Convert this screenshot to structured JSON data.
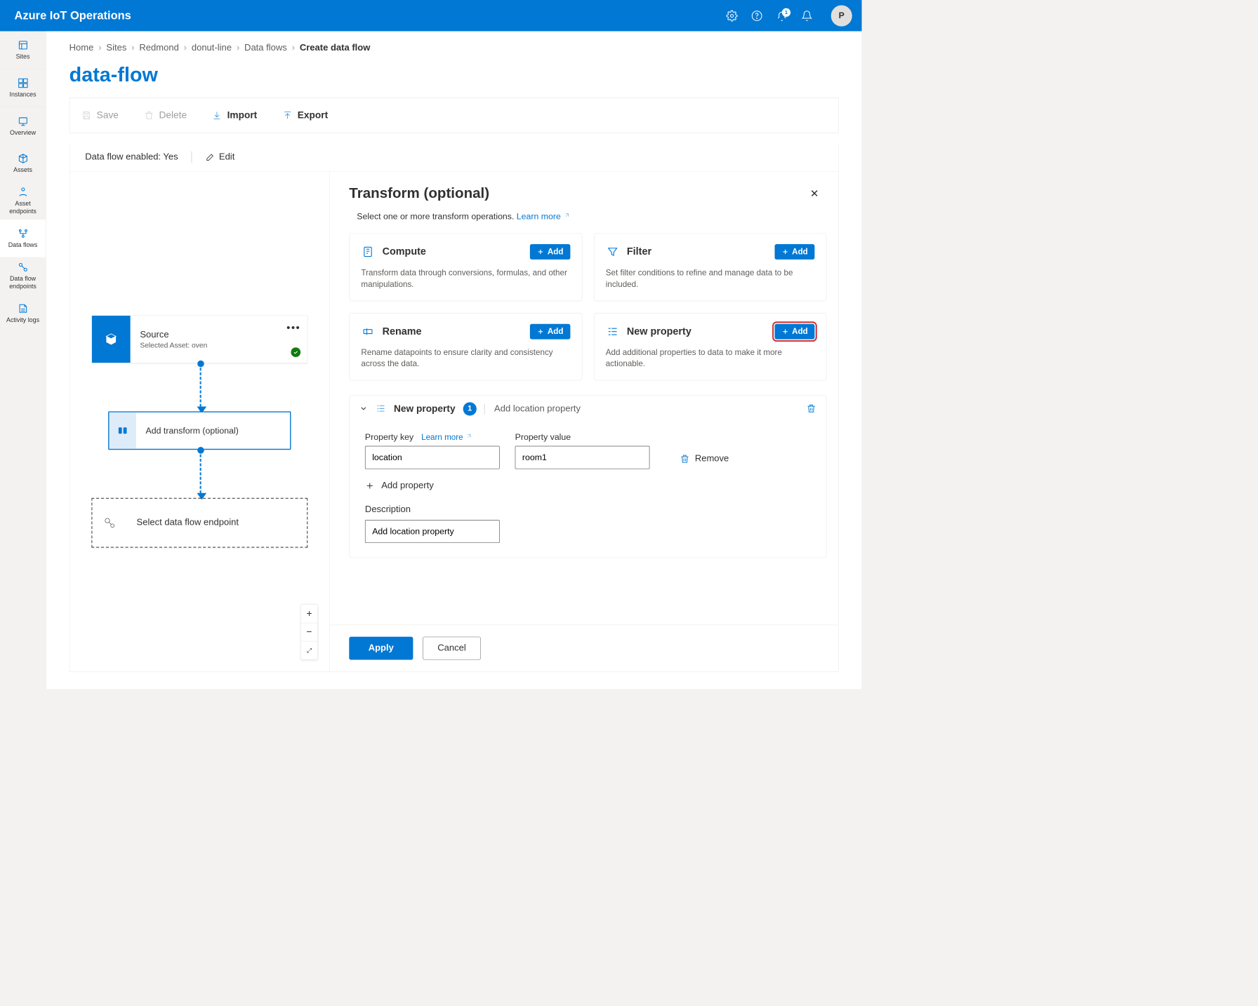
{
  "brand": "Azure IoT Operations",
  "alerts_badge": "1",
  "avatar_initial": "P",
  "nav": {
    "sites": "Sites",
    "instances": "Instances",
    "overview": "Overview",
    "assets": "Assets",
    "asset_endpoints": "Asset endpoints",
    "data_flows": "Data flows",
    "data_flow_endpoints": "Data flow endpoints",
    "activity_logs": "Activity logs"
  },
  "breadcrumb": {
    "home": "Home",
    "sites": "Sites",
    "redmond": "Redmond",
    "donut": "donut-line",
    "flows": "Data flows",
    "current": "Create data flow"
  },
  "page_title": "data-flow",
  "toolbar": {
    "save": "Save",
    "delete": "Delete",
    "import": "Import",
    "export": "Export"
  },
  "status": {
    "enabled_label": "Data flow enabled: Yes",
    "edit": "Edit"
  },
  "canvas": {
    "source_title": "Source",
    "source_sub": "Selected Asset: oven",
    "transform_title": "Add transform (optional)",
    "endpoint_title": "Select data flow endpoint"
  },
  "panel": {
    "title": "Transform (optional)",
    "subtitle": "Select one or more transform operations.",
    "learn_more": "Learn more",
    "add": "Add",
    "cards": {
      "compute": {
        "title": "Compute",
        "desc": "Transform data through conversions, formulas, and other manipulations."
      },
      "filter": {
        "title": "Filter",
        "desc": "Set filter conditions to refine and manage data to be included."
      },
      "rename": {
        "title": "Rename",
        "desc": "Rename datapoints to ensure clarity and consistency across the data."
      },
      "newprop": {
        "title": "New property",
        "desc": "Add additional properties to data to make it more actionable."
      }
    },
    "np": {
      "title": "New property",
      "count": "1",
      "summary": "Add location property",
      "key_label": "Property key",
      "val_label": "Property value",
      "learn_more": "Learn more",
      "key_value": "location",
      "val_value": "room1",
      "remove": "Remove",
      "add_prop": "Add property",
      "description_label": "Description",
      "description_value": "Add location property"
    },
    "apply": "Apply",
    "cancel": "Cancel"
  }
}
